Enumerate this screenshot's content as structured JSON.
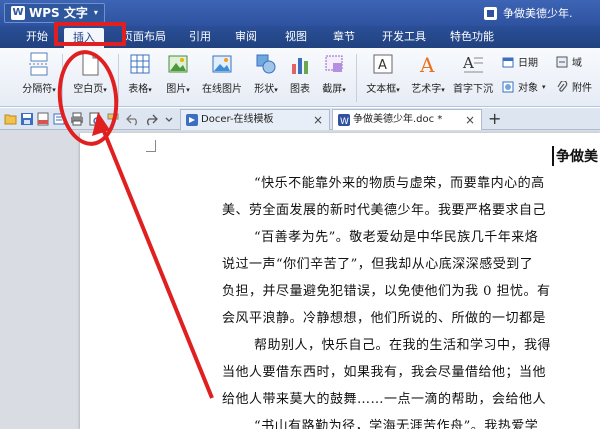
{
  "app": {
    "menu_label": "WPS 文字",
    "logo_text": "W",
    "caret": "▾",
    "document_title": "争做美德少年."
  },
  "tabs": [
    {
      "label": "开始"
    },
    {
      "label": "插入",
      "active": true
    },
    {
      "label": "页面布局"
    },
    {
      "label": "引用"
    },
    {
      "label": "审阅"
    },
    {
      "label": "视图"
    },
    {
      "label": "章节"
    },
    {
      "label": "开发工具"
    },
    {
      "label": "特色功能"
    }
  ],
  "ribbon": {
    "buttons": [
      {
        "label": "分隔符",
        "icon": "page-break-icon",
        "dropdown": true
      },
      {
        "label": "空白页",
        "icon": "blank-page-icon",
        "dropdown": true
      },
      {
        "label": "表格",
        "icon": "table-icon",
        "dropdown": true
      },
      {
        "label": "图片",
        "icon": "picture-icon",
        "dropdown": true
      },
      {
        "label": "在线图片",
        "icon": "online-picture-icon",
        "dropdown": false
      },
      {
        "label": "形状",
        "icon": "shapes-icon",
        "dropdown": true
      },
      {
        "label": "图表",
        "icon": "chart-icon",
        "dropdown": false
      },
      {
        "label": "截屏",
        "icon": "screenshot-icon",
        "dropdown": true
      },
      {
        "label": "文本框",
        "icon": "text-box-icon",
        "dropdown": true
      },
      {
        "label": "艺术字",
        "icon": "word-art-icon",
        "dropdown": true
      },
      {
        "label": "首字下沉",
        "icon": "drop-cap-icon",
        "dropdown": false
      }
    ],
    "small": {
      "date": "日期",
      "object": "对象",
      "field": "域",
      "attachment": "附件"
    },
    "dropdown_mark": "▾"
  },
  "document_tabs": [
    {
      "label": "Docer-在线模板",
      "close": "×"
    },
    {
      "label": "争做美德少年.doc *",
      "close": "×"
    }
  ],
  "add_tab": "+",
  "document": {
    "heading": "争做美",
    "lines": [
      "“快乐不能靠外来的物质与虚荣，而要靠内心的高",
      "美、劳全面发展的新时代美德少年。我要严格要求自己",
      "“百善孝为先”。敬老爱幼是中华民族几千年来烙",
      "说过一声“你们辛苦了”，但我却从心底深深感受到了",
      "负担，并尽量避免犯错误，以免使他们为我 0 担忧。有",
      "会风平浪静。冷静想想，他们所说的、所做的一切都是",
      "帮助别人，快乐自己。在我的生活和学习中，我得",
      "当他人要借东西时，如果我有，我会尽量借给他；当他",
      "给他人带来莫大的鼓舞……一点一滴的帮助，会给他人",
      "“书山有路勤为径，学海无涯苦作舟”。我热爱学"
    ]
  },
  "colors": {
    "annotation_red": "#e02020",
    "title_bar_blue": "#2e529f",
    "active_tab_text": "#1f3f85"
  }
}
